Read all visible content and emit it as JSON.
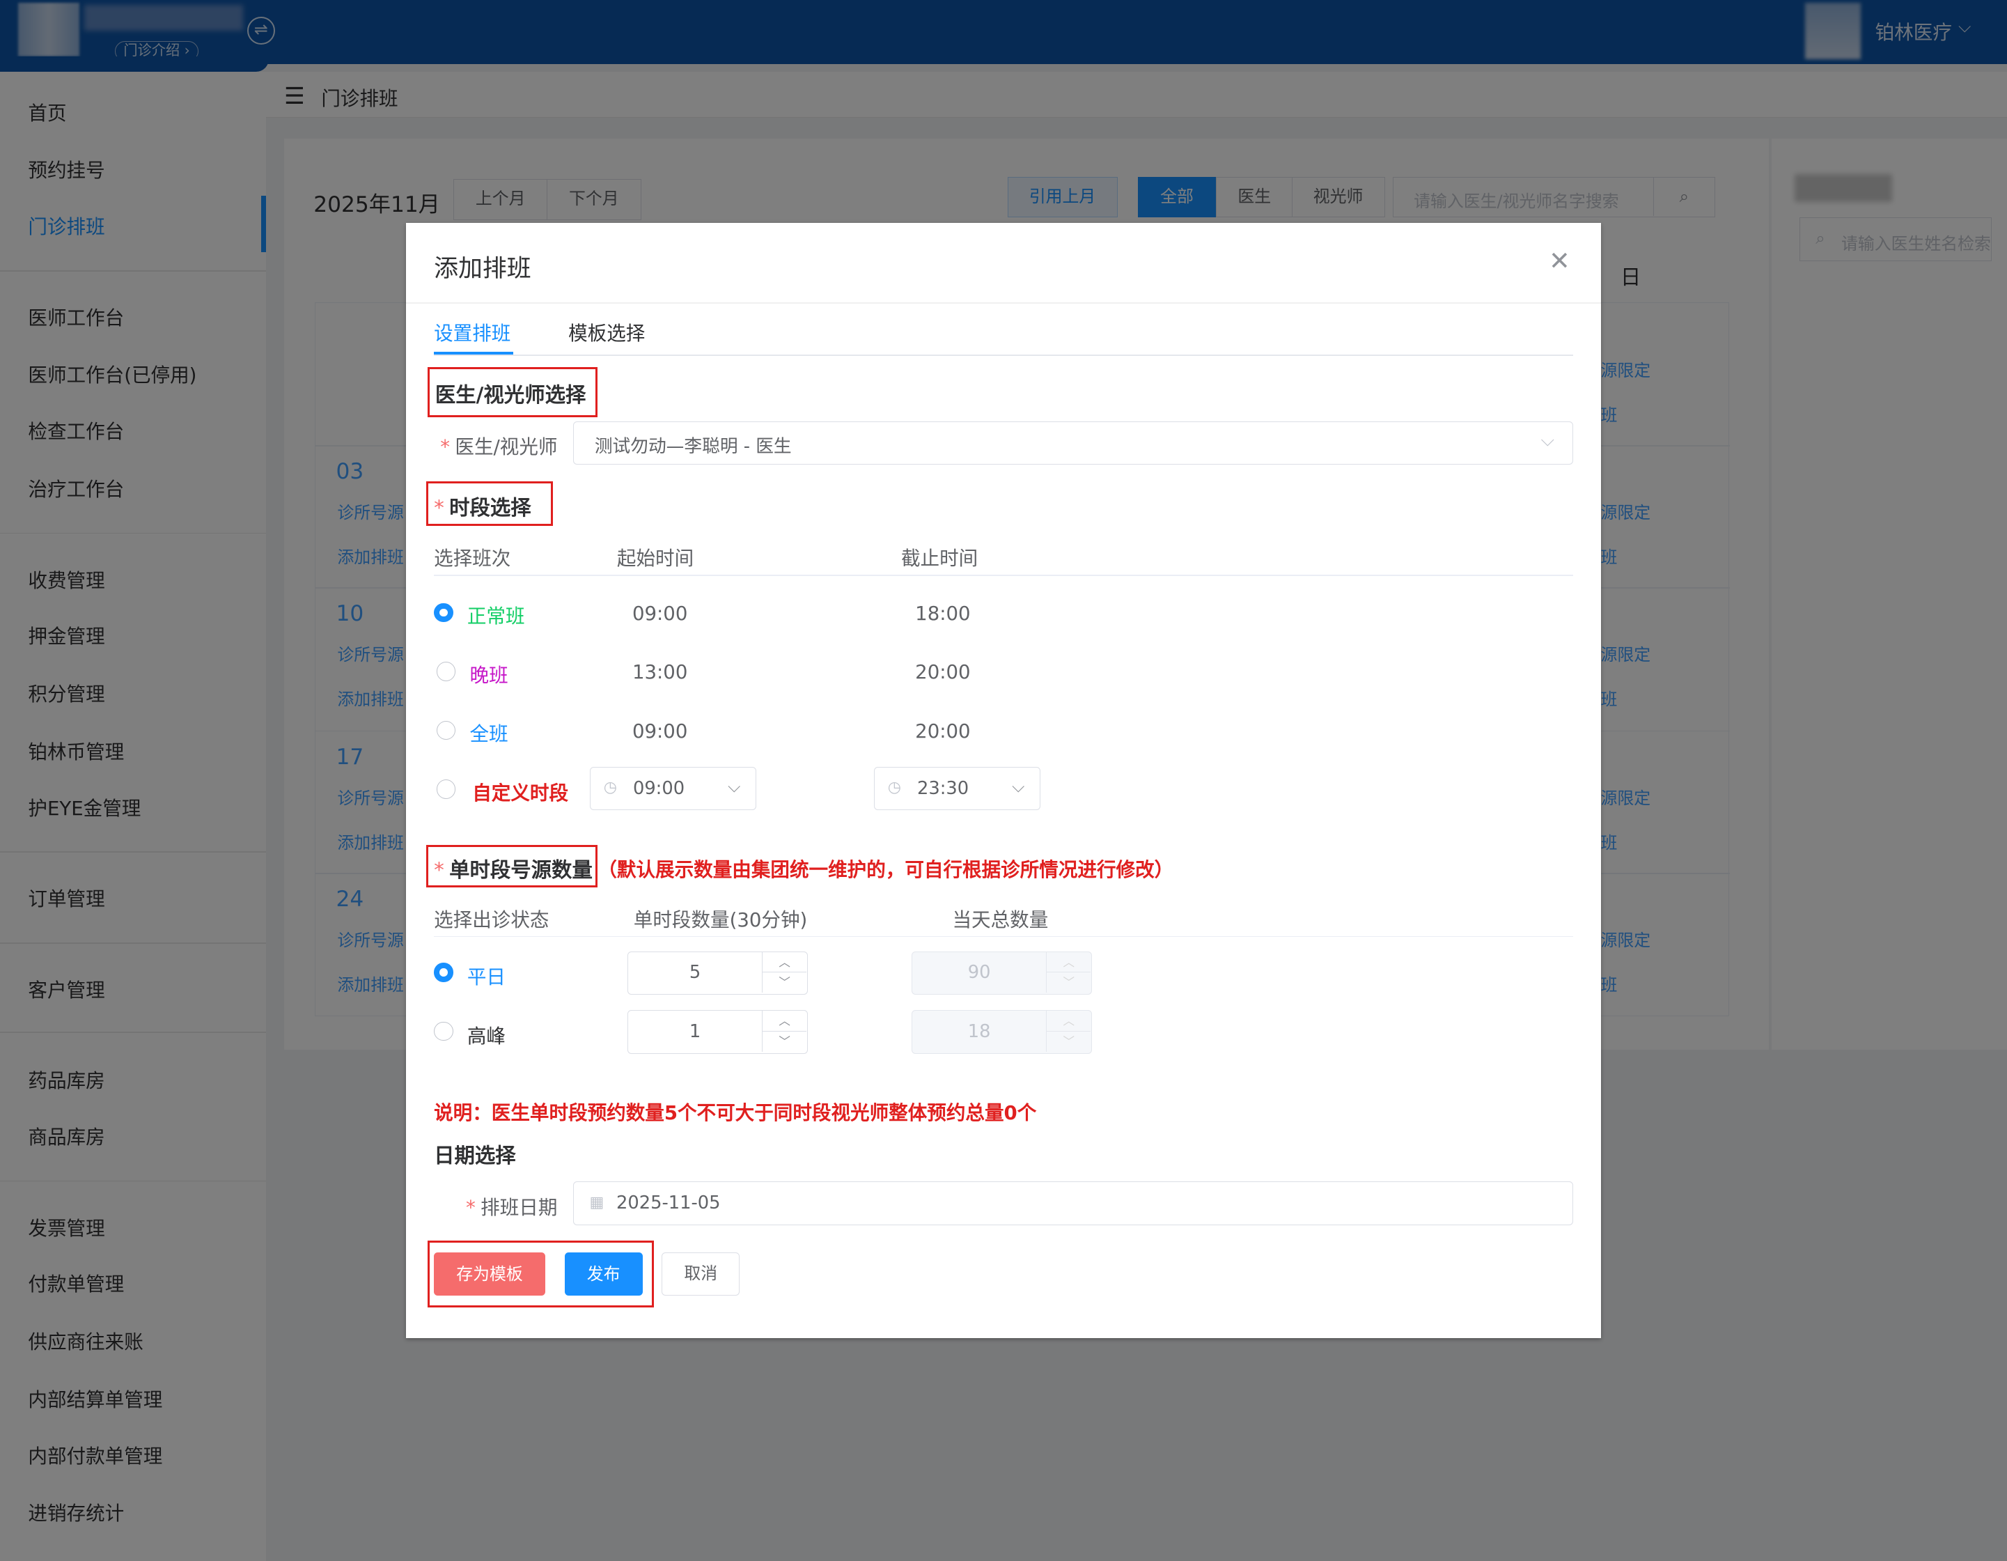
{
  "header": {
    "intro_label": "门诊介绍",
    "intro_chevron": "›",
    "switch_icon": "⇌",
    "org_name": "铂林医疗",
    "caret": "⌵"
  },
  "sidebar": {
    "items": [
      "首页",
      "预约挂号",
      "门诊排班",
      "医师工作台",
      "医师工作台(已停用)",
      "检查工作台",
      "治疗工作台",
      "收费管理",
      "押金管理",
      "积分管理",
      "铂林币管理",
      "护EYE金管理",
      "订单管理",
      "客户管理",
      "药品库房",
      "商品库房",
      "发票管理",
      "付款单管理",
      "供应商往来账",
      "内部结算单管理",
      "内部付款单管理",
      "进销存统计"
    ],
    "active": "门诊排班"
  },
  "page": {
    "menu_icon": "☰",
    "title": "门诊排班",
    "month": "2025年11月",
    "prev_month": "上个月",
    "next_month": "下个月",
    "cite_last": "引用上月",
    "filters": [
      "全部",
      "医生",
      "视光师"
    ],
    "search_placeholder": "请输入医生/视光师名字搜索",
    "search_icon": "⌕",
    "right_search_placeholder": "请输入医生姓名检索",
    "sunday": "日",
    "weeks": [
      {
        "date": "03",
        "link1": "诊所号源",
        "link2": "添加排班"
      },
      {
        "date": "10",
        "link1": "诊所号源",
        "link2": "添加排班"
      },
      {
        "date": "17",
        "link1": "诊所号源",
        "link2": "添加排班"
      },
      {
        "date": "24",
        "link1": "诊所号源",
        "link2": "添加排班"
      }
    ],
    "right_col_link1": "源限定",
    "right_col_link2": "班"
  },
  "dialog": {
    "title": "添加排班",
    "close": "✕",
    "tabs": [
      "设置排班",
      "模板选择"
    ],
    "sec_doctor": "医生/视光师选择",
    "doctor_label": "医生/视光师",
    "doctor_value": "测试勿动—李聪明 - 医生",
    "caret": "⌵",
    "sec_time": "时段选择",
    "time_headers": [
      "选择班次",
      "起始时间",
      "截止时间"
    ],
    "shifts": [
      {
        "name": "正常班",
        "start": "09:00",
        "end": "18:00",
        "color": "#13ce66",
        "checked": true
      },
      {
        "name": "晚班",
        "start": "13:00",
        "end": "20:00",
        "color": "#c616c8",
        "checked": false
      },
      {
        "name": "全班",
        "start": "09:00",
        "end": "20:00",
        "color": "#1890ff",
        "checked": false
      }
    ],
    "custom_shift": {
      "name": "自定义时段",
      "start": "09:00",
      "end": "23:30",
      "color": "#e0201f"
    },
    "clock_icon": "◷",
    "sec_quota": "单时段号源数量",
    "quota_note": "（默认展示数量由集团统一维护的，可自行根据诊所情况进行修改）",
    "quota_headers": [
      "选择出诊状态",
      "单时段数量(30分钟)",
      "当天总数量"
    ],
    "quotas": [
      {
        "name": "平日",
        "per_slot": "5",
        "total": "90",
        "checked": true
      },
      {
        "name": "高峰",
        "per_slot": "1",
        "total": "18",
        "checked": false
      }
    ],
    "stepper_up": "︿",
    "stepper_down": "﹀",
    "explain": "说明：医生单时段预约数量5个不可大于同时段视光师整体预约总量0个",
    "sec_date": "日期选择",
    "date_label": "排班日期",
    "date_icon": "▦",
    "date_value": "2025-11-05",
    "btn_template": "存为模板",
    "btn_publish": "发布",
    "btn_cancel": "取消",
    "colors": {
      "primary": "#1890ff",
      "danger_red": "#e0201f",
      "template_btn": "#f56c6c"
    }
  }
}
